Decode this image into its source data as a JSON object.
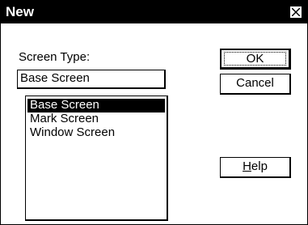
{
  "window": {
    "title": "New"
  },
  "form": {
    "screen_type_label": "Screen Type:",
    "screen_type_value": "Base Screen",
    "options": [
      {
        "label": "Base Screen",
        "selected": true
      },
      {
        "label": "Mark Screen",
        "selected": false
      },
      {
        "label": "Window Screen",
        "selected": false
      }
    ]
  },
  "buttons": {
    "ok": "OK",
    "cancel": "Cancel",
    "help_mnemonic": "H",
    "help_rest": "elp"
  },
  "icons": {
    "close": "close-icon"
  }
}
